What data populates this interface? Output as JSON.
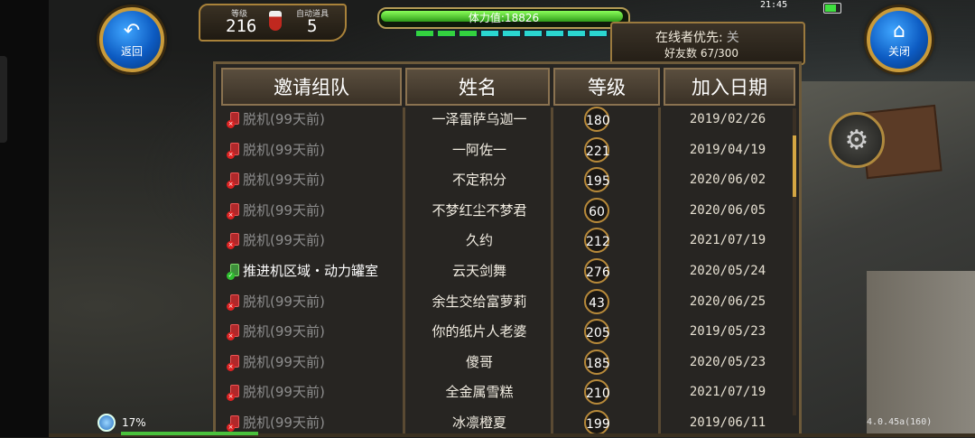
{
  "hud": {
    "back_label": "返回",
    "close_label": "关闭",
    "level_label": "等级",
    "level_value": "216",
    "auto_item_label": "自动道具",
    "auto_item_value": "5",
    "stamina_text": "体力值:18826",
    "online_priority_label": "在线者优先:",
    "online_priority_value": "关",
    "friends_count": "好友数 67/300",
    "clock": "21:45",
    "load_percent": "17%",
    "version": "4.0.45a(160)"
  },
  "table": {
    "headers": [
      "邀请组队",
      "姓名",
      "等级",
      "加入日期"
    ],
    "rows": [
      {
        "status": "脱机(99天前)",
        "online": false,
        "name": "一泽雷萨乌迦一",
        "level": "180",
        "date": "2019/02/26"
      },
      {
        "status": "脱机(99天前)",
        "online": false,
        "name": "一阿佐一",
        "level": "221",
        "date": "2019/04/19"
      },
      {
        "status": "脱机(99天前)",
        "online": false,
        "name": "不定积分",
        "level": "195",
        "date": "2020/06/02"
      },
      {
        "status": "脱机(99天前)",
        "online": false,
        "name": "不梦红尘不梦君",
        "level": "60",
        "date": "2020/06/05"
      },
      {
        "status": "脱机(99天前)",
        "online": false,
        "name": "久约",
        "level": "212",
        "date": "2021/07/19"
      },
      {
        "status": "推进机区域・动力罐室",
        "online": true,
        "name": "云天剑舞",
        "level": "276",
        "date": "2020/05/24"
      },
      {
        "status": "脱机(99天前)",
        "online": false,
        "name": "余生交给富萝莉",
        "level": "43",
        "date": "2020/06/25"
      },
      {
        "status": "脱机(99天前)",
        "online": false,
        "name": "你的纸片人老婆",
        "level": "205",
        "date": "2019/05/23"
      },
      {
        "status": "脱机(99天前)",
        "online": false,
        "name": "傻哥",
        "level": "185",
        "date": "2020/05/23"
      },
      {
        "status": "脱机(99天前)",
        "online": false,
        "name": "全金属雪糕",
        "level": "210",
        "date": "2021/07/19"
      },
      {
        "status": "脱机(99天前)",
        "online": false,
        "name": "冰凛橙夏",
        "level": "199",
        "date": "2019/06/11"
      }
    ]
  },
  "icons": {
    "back": "back-arrow-icon",
    "close": "home-icon",
    "settings": "gear-icon",
    "offline": "phone-offline-icon",
    "online": "phone-online-icon"
  }
}
